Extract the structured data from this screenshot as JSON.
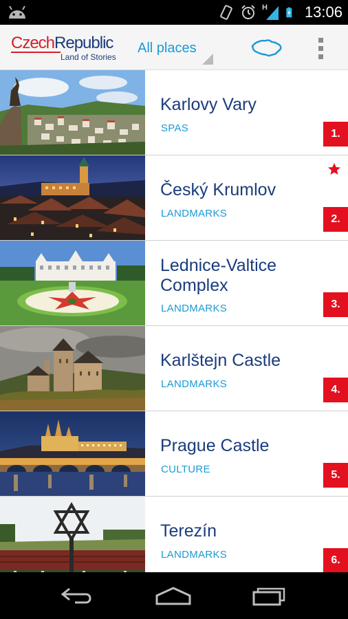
{
  "status_bar": {
    "time": "13:06",
    "network_label": "H",
    "icons": [
      "android-icon",
      "vibrate-icon",
      "alarm-icon",
      "signal-icon",
      "battery-charging-icon"
    ]
  },
  "action_bar": {
    "logo_czech": "Czech",
    "logo_republic": "Republic",
    "logo_tagline": "Land of Stories",
    "filter_selected": "All places",
    "map_icon": "czech-map-icon",
    "menu_icon": "overflow-menu-icon"
  },
  "places": [
    {
      "title": "Karlovy Vary",
      "category": "SPAS",
      "rank": "1.",
      "favorite": false
    },
    {
      "title": "Český Krumlov",
      "category": "LANDMARKS",
      "rank": "2.",
      "favorite": true
    },
    {
      "title": "Lednice-Valtice Complex",
      "category": "LANDMARKS",
      "rank": "3.",
      "favorite": false
    },
    {
      "title": "Karlštejn Castle",
      "category": "LANDMARKS",
      "rank": "4.",
      "favorite": false
    },
    {
      "title": "Prague Castle",
      "category": "CULTURE",
      "rank": "5.",
      "favorite": false
    },
    {
      "title": "Terezín",
      "category": "LANDMARKS",
      "rank": "6.",
      "favorite": false
    }
  ],
  "nav_bar": {
    "icons": [
      "back-icon",
      "home-icon",
      "recent-apps-icon"
    ]
  },
  "colors": {
    "brand_red": "#e3101f",
    "brand_navy": "#1a3c7c",
    "accent_blue": "#1a9ad6"
  }
}
